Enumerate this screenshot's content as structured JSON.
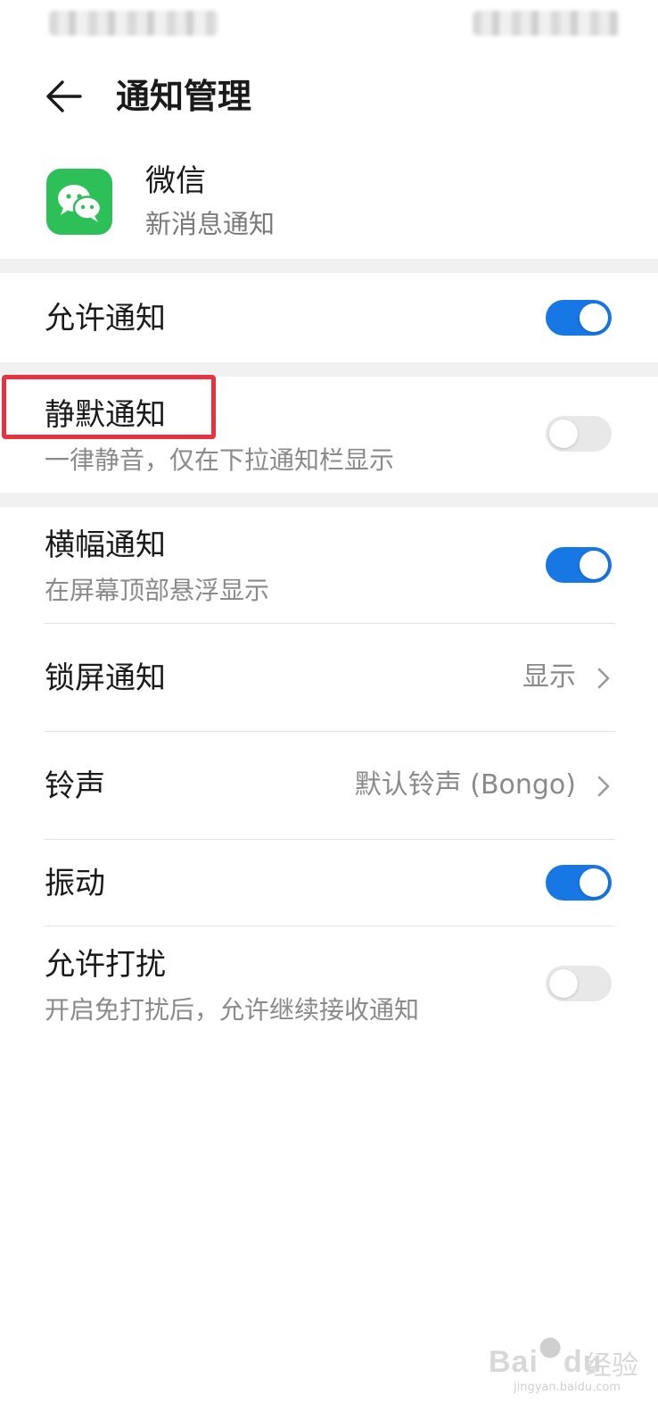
{
  "header": {
    "title": "通知管理",
    "back_icon": "arrow-left-icon"
  },
  "app": {
    "name": "微信",
    "subtitle": "新消息通知",
    "icon": "wechat-icon",
    "icon_color": "#2ec058"
  },
  "settings": {
    "allow_notifications": {
      "label": "允许通知",
      "enabled": true
    },
    "silent_notifications": {
      "label": "静默通知",
      "description": "一律静音，仅在下拉通知栏显示",
      "enabled": false
    },
    "banner_notifications": {
      "label": "横幅通知",
      "description": "在屏幕顶部悬浮显示",
      "enabled": true
    },
    "lock_screen_notifications": {
      "label": "锁屏通知",
      "value": "显示"
    },
    "ringtone": {
      "label": "铃声",
      "value": "默认铃声 (Bongo)"
    },
    "vibration": {
      "label": "振动",
      "enabled": true
    },
    "allow_interruptions": {
      "label": "允许打扰",
      "description": "开启免打扰后，允许继续接收通知",
      "enabled": false
    }
  },
  "colors": {
    "toggle_on": "#1677e5",
    "toggle_off": "#e8e8e8",
    "highlight": "#e8323f"
  },
  "watermark": {
    "brand": "Bai",
    "brand2": "du",
    "cn": "经验",
    "url": "jingyan.baidu.com"
  }
}
